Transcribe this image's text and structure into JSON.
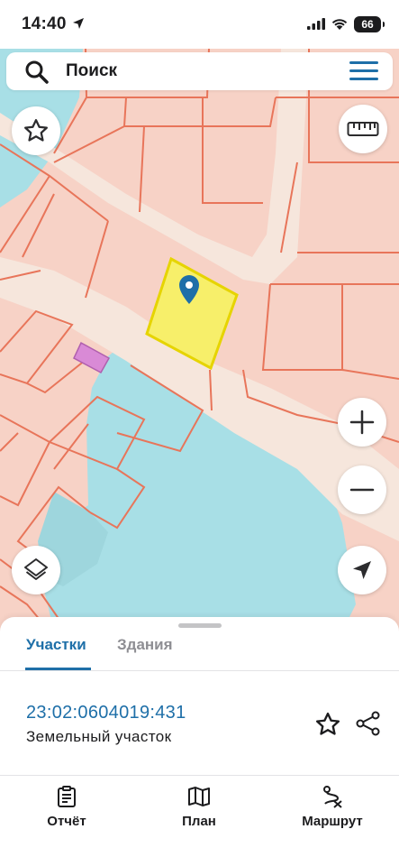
{
  "status_bar": {
    "time": "14:40",
    "battery": "66"
  },
  "search": {
    "placeholder": "Поиск"
  },
  "map": {
    "colors": {
      "land": "#f7d2c6",
      "parcel_border": "#e8755a",
      "road": "#f6e6dc",
      "water": "#a8dfe6",
      "selected_parcel": "#f7ef6a",
      "selected_border": "#e6d400",
      "marker": "#1e6fa8",
      "building": "#d98ad6"
    },
    "controls": [
      "favorite",
      "ruler",
      "zoom-in",
      "zoom-out",
      "layers",
      "my-location"
    ]
  },
  "sheet": {
    "tabs": [
      {
        "label": "Участки",
        "active": true
      },
      {
        "label": "Здания",
        "active": false
      }
    ],
    "parcel": {
      "number": "23:02:0604019:431",
      "type": "Земельный участок"
    }
  },
  "bottom_nav": {
    "items": [
      {
        "label": "Отчёт",
        "icon": "report-icon"
      },
      {
        "label": "План",
        "icon": "map-plan-icon"
      },
      {
        "label": "Маршрут",
        "icon": "route-icon"
      }
    ]
  }
}
